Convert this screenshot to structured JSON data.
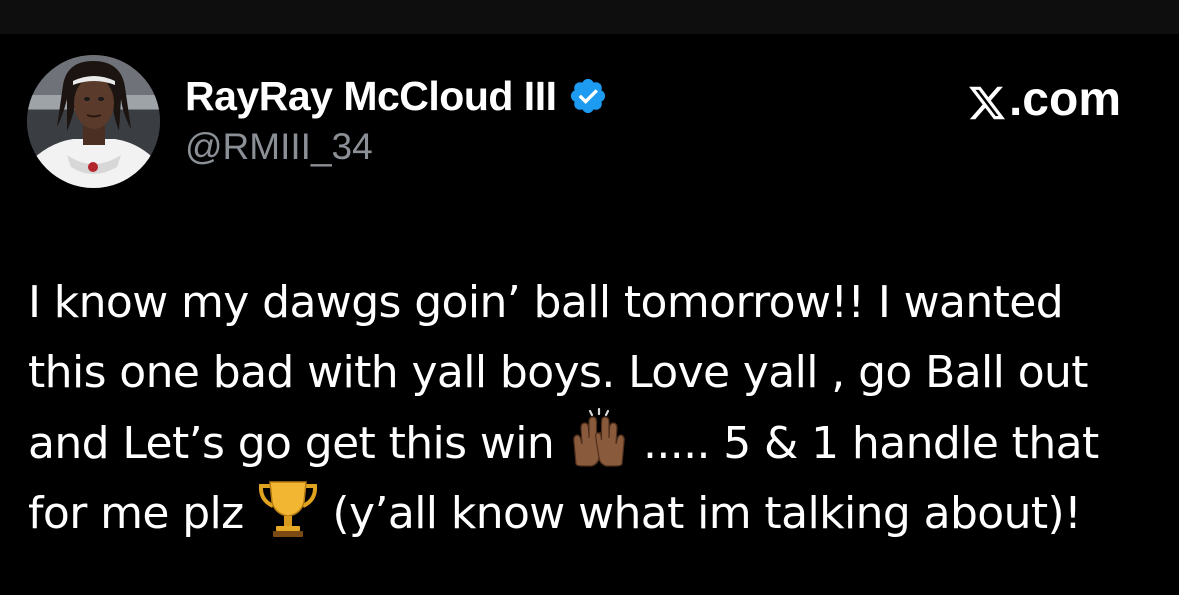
{
  "author": {
    "display_name": "RayRay McCloud III",
    "handle": "@RMIII_34",
    "verified": true,
    "verified_color": "#1d9bf0"
  },
  "brand": {
    "label": ".com",
    "logo": "x-logo-icon"
  },
  "tweet": {
    "line1": "I know my dawgs goin’ ball tomorrow!! I wanted",
    "line2": "this one bad with yall boys. Love yall , go Ball out",
    "line3_a": "and Let’s go get this win ",
    "line3_emoji": "raising-hands-icon",
    "line3_b": " ..... 5 & 1 handle that",
    "line4_a": "for me plz ",
    "line4_emoji": "trophy-icon",
    "line4_b": "  (y’all know what im talking about)!"
  },
  "colors": {
    "background": "#000000",
    "text": "#ffffff",
    "secondary_text": "#8b9096"
  }
}
